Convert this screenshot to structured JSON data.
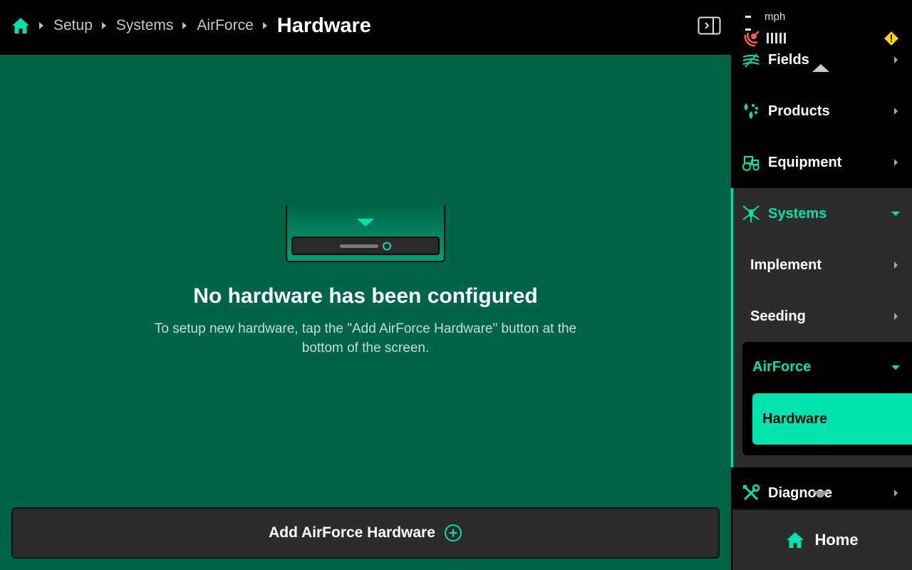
{
  "breadcrumb": {
    "home_icon": "home-icon",
    "items": [
      "Setup",
      "Systems",
      "AirForce"
    ],
    "current": "Hardware"
  },
  "empty_state": {
    "title": "No hardware has been configured",
    "subtitle": "To setup new hardware, tap the \"Add AirForce Hardware\" button at the bottom of the screen."
  },
  "add_button": {
    "label": "Add AirForce Hardware",
    "icon": "plus-circle-icon"
  },
  "status": {
    "speed_value": "--",
    "speed_unit": "mph",
    "gps_icon": "satellite-icon",
    "signal_bars": 5,
    "warning_icon": "warning-icon"
  },
  "sidebar": {
    "items": [
      {
        "label": "Fields",
        "icon": "fields-icon"
      },
      {
        "label": "Products",
        "icon": "products-icon"
      },
      {
        "label": "Equipment",
        "icon": "tractor-icon"
      },
      {
        "label": "Systems",
        "icon": "systems-icon",
        "expanded": true
      },
      {
        "label": "Diagnose",
        "icon": "tools-icon"
      }
    ],
    "systems_children": [
      "Implement",
      "Seeding"
    ],
    "airforce": {
      "label": "AirForce",
      "children": [
        "Hardware"
      ]
    },
    "home_label": "Home"
  },
  "colors": {
    "accent": "#00e3ae",
    "main_bg": "#006548",
    "panel_bg": "#2c2c2c",
    "warning": "#ffd600",
    "gps_error": "#ff5a4a"
  }
}
